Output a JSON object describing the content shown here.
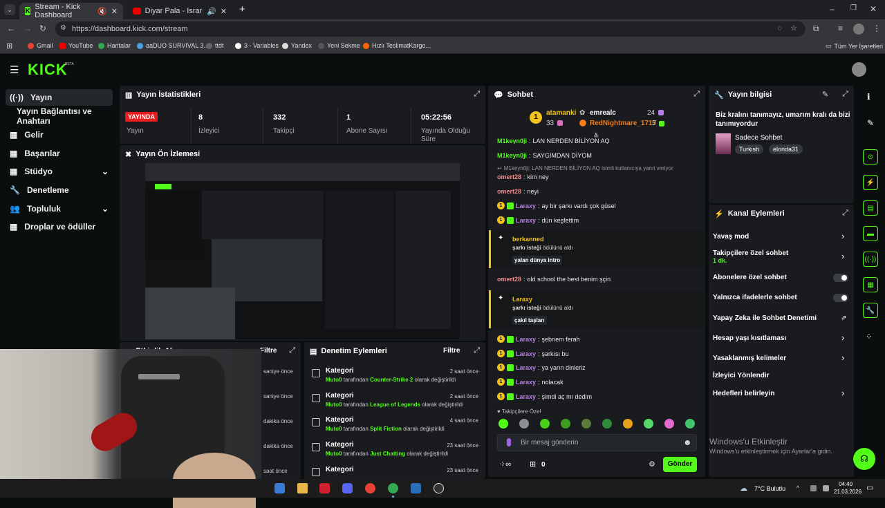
{
  "browser": {
    "tabs": [
      {
        "title": "Stream - Kick Dashboard"
      },
      {
        "title": "Diyar Pala - IsrarCash Feat."
      }
    ],
    "new_tab": "+",
    "url": "https://dashboard.kick.com/stream",
    "bookmarks": [
      "Gmail",
      "YouTube",
      "Haritalar",
      "aaDUO SURVIVAL 3...",
      "ttdt",
      "3 - Variables",
      "Yandex",
      "Yeni Sekme",
      "Hızlı TeslimatKargo..."
    ],
    "all_bookmarks": "Tüm Yer İşaretleri"
  },
  "kick": {
    "logo": "KICK",
    "logo_sup": "BETA",
    "sidebar": [
      {
        "label": "Yayın",
        "icon": "broadcast-icon",
        "active": true
      },
      {
        "label": "Yayın Bağlantısı ve Anahtarı",
        "icon": "",
        "active": false
      },
      {
        "label": "Gelir",
        "icon": "revenue-icon",
        "active": false
      },
      {
        "label": "Başarılar",
        "icon": "trophy-icon",
        "active": false
      },
      {
        "label": "Stüdyo",
        "icon": "studio-icon",
        "active": false,
        "chevron": true
      },
      {
        "label": "Denetleme",
        "icon": "wrench-icon",
        "active": false
      },
      {
        "label": "Topluluk",
        "icon": "community-icon",
        "active": false,
        "chevron": true
      },
      {
        "label": "Droplar ve ödüller",
        "icon": "drops-icon",
        "active": false
      }
    ],
    "stats": {
      "title": "Yayın İstatistikleri",
      "live_badge": "YAYINDA",
      "items": [
        {
          "value": "",
          "label": "Yayın"
        },
        {
          "value": "8",
          "label": "İzleyici"
        },
        {
          "value": "332",
          "label": "Takipçi"
        },
        {
          "value": "1",
          "label": "Abone Sayısı"
        },
        {
          "value": "05:22:56",
          "label": "Yayında Olduğu Süre"
        }
      ]
    },
    "preview_title": "Yayın Ön İzlemesi",
    "activity": {
      "title": "Etkinlik Akışı",
      "filter": "Filtre",
      "times": [
        "saniye önce",
        "saniye önce",
        "dakika önce",
        "dakika önce",
        "saat önce"
      ]
    },
    "mod_actions": {
      "title": "Denetim Eylemleri",
      "filter": "Filtre",
      "items": [
        {
          "title": "Kategori",
          "time": "2 saat önce",
          "user": "Muto0",
          "mid": "tarafından",
          "target": "Counter-Strike 2",
          "end": "olarak değiştirildi"
        },
        {
          "title": "Kategori",
          "time": "2 saat önce",
          "user": "Muto0",
          "mid": "tarafından",
          "target": "League of Legends",
          "end": "olarak değiştirildi"
        },
        {
          "title": "Kategori",
          "time": "4 saat önce",
          "user": "Muto0",
          "mid": "tarafından",
          "target": "Split Fiction",
          "end": "olarak değiştirildi"
        },
        {
          "title": "Kategori",
          "time": "23 saat önce",
          "user": "Muto0",
          "mid": "tarafından",
          "target": "Just Chatting",
          "end": "olarak değiştirildi"
        },
        {
          "title": "Kategori",
          "time": "23 saat önce"
        }
      ]
    },
    "chat": {
      "title": "Sohbet",
      "leaders": [
        {
          "rank": "1",
          "name": "atamanki",
          "count": "33"
        },
        {
          "name": "emrealc",
          "count": "24"
        },
        {
          "name": "RedNightmare_1717",
          "count": "5"
        }
      ],
      "messages": [
        {
          "user": "M1keyn0ji",
          "text": "LAN NERDEN BİLİYON AQ"
        },
        {
          "user": "M1keyn0ji",
          "text": "SAYGIMDAN DİYOM"
        },
        {
          "reply": "M1keyn0ji: LAN NERDEN BİLİYON AQ isimli kullanıcıya yanıt veriyor"
        },
        {
          "user": "omert28",
          "text": "kim ney"
        },
        {
          "user": "omert28",
          "text": "neyi"
        },
        {
          "user": "Laraxy",
          "text": "ay bir şarkı vardı çok güsel"
        },
        {
          "user": "Laraxy",
          "text": "dün keşfettim"
        },
        {
          "reward_user": "berkanned",
          "reward_pre": "şarkı isteği",
          "reward_mid": "ödülünü aldı",
          "reward_value": "yalan dünya intro"
        },
        {
          "user": "omert28",
          "text": "old school the best benim şçin"
        },
        {
          "reward_user": "Laraxy",
          "reward_pre": "şarkı isteği",
          "reward_mid": "ödülünü aldı",
          "reward_value": "çakıl taşları"
        },
        {
          "user": "Laraxy",
          "text": "şebnem ferah"
        },
        {
          "user": "Laraxy",
          "text": "şarkısı bu"
        },
        {
          "user": "Laraxy",
          "text": "ya yarın dinleriz"
        },
        {
          "user": "Laraxy",
          "text": "nolacak"
        },
        {
          "user": "Laraxy",
          "text": "şimdi aç mı dedim"
        }
      ],
      "follower_only": "Takipçilere Özel",
      "input_placeholder": "Bir mesaj gönderin",
      "points": "0",
      "send": "Gönder"
    },
    "stream_info": {
      "title": "Yayın bilgisi",
      "text": "Biz kralını tanımayız, umarım kralı da bizi tanımıyordur",
      "category": "Sadece Sohbet",
      "tags": [
        "Turkish",
        "elonda31"
      ]
    },
    "channel_actions": {
      "title": "Kanal Eylemleri",
      "rows": [
        {
          "label": "Yavaş mod",
          "control": "chevron"
        },
        {
          "label": "Takipçilere özel sohbet",
          "sub": "1 dk.",
          "control": "chevron"
        },
        {
          "label": "Abonelere özel sohbet",
          "control": "toggle"
        },
        {
          "label": "Yalnızca ifadelerle sohbet",
          "control": "toggle"
        },
        {
          "label": "Yapay Zeka ile Sohbet Denetimi",
          "control": "external"
        },
        {
          "label": "Hesap yaşı kısıtlaması",
          "control": "chevron"
        },
        {
          "label": "Yasaklanmış kelimeler",
          "control": "chevron"
        },
        {
          "label": "İzleyici Yönlendir",
          "control": "none"
        },
        {
          "label": "Hedefleri belirleyin",
          "control": "chevron"
        }
      ]
    },
    "windows_watermark": {
      "title": "Windows'u Etkinleştir",
      "sub": "Windows'u etkinleştirmek için Ayarlar'a gidin."
    }
  },
  "taskbar": {
    "weather": "7°C Bulutlu",
    "time": "04:40",
    "date": "21.03.2026"
  },
  "colors": {
    "kick_green": "#53fc18",
    "bg": "#0b0e0f",
    "panel": "#191b1f",
    "live_red": "#e81e1e",
    "badge_gold": "#f1c21b"
  }
}
